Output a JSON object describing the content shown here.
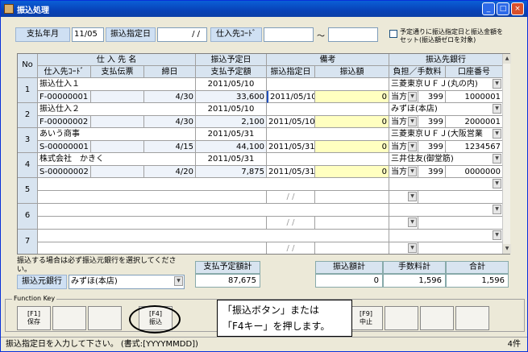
{
  "window": {
    "title": "振込処理",
    "minimize": "_",
    "maximize": "□",
    "close": "×"
  },
  "header": {
    "year_month_label": "支払年月",
    "year_month_value": "11/05",
    "transfer_date_label": "振込指定日",
    "transfer_date_value": "/ /",
    "supplier_code_label": "仕入先ｺｰﾄﾞ",
    "range_sep": "～",
    "checkbox_text": "予定通りに振込指定日と振込金額をセット(振込額ゼロを対象)"
  },
  "grid": {
    "h_no": "No",
    "h_supplier": "仕 入 先 名",
    "h_scheduled_date": "振込予定日",
    "h_remarks": "備考",
    "h_bank": "振込先銀行",
    "h_code": "仕入先ｺｰﾄﾞ",
    "h_slip": "支払伝票",
    "h_close": "締日",
    "h_scheduled_amount": "支払予定額",
    "h_designated": "振込指定日",
    "h_amount": "振込額",
    "h_fee": "負担／手数料",
    "h_account": "口座番号",
    "rows": [
      {
        "no": "1",
        "name": "振込仕入１",
        "code": "F-00000001",
        "close": "4/30",
        "date": "2011/05/10",
        "amount": "33,600",
        "designated": "2011/05/10",
        "transfer": "0",
        "bank": "三菱東京ＵＦＪ(丸の内)",
        "burden": "当方",
        "fee": "399",
        "account": "1000001"
      },
      {
        "no": "2",
        "name": "振込仕入２",
        "code": "F-00000002",
        "close": "4/30",
        "date": "2011/05/10",
        "amount": "2,100",
        "designated": "2011/05/10",
        "transfer": "0",
        "bank": "みずほ(本店)",
        "burden": "当方",
        "fee": "399",
        "account": "2000001"
      },
      {
        "no": "3",
        "name": "あいう商事",
        "code": "S-00000001",
        "close": "4/15",
        "date": "2011/05/31",
        "amount": "44,100",
        "designated": "2011/05/31",
        "transfer": "0",
        "bank": "三菱東京ＵＦＪ(大阪営業",
        "burden": "当方",
        "fee": "399",
        "account": "1234567"
      },
      {
        "no": "4",
        "name": "株式会社　かきく",
        "code": "S-00000002",
        "close": "4/20",
        "date": "2011/05/31",
        "amount": "7,875",
        "designated": "2011/05/31",
        "transfer": "0",
        "bank": "三井住友(御堂筋)",
        "burden": "当方",
        "fee": "399",
        "account": "0000000"
      },
      {
        "no": "5",
        "designated": "/ /"
      },
      {
        "no": "6",
        "designated": "/ /"
      },
      {
        "no": "7",
        "designated": "/ /"
      }
    ]
  },
  "footer": {
    "note": "振込する場合は必ず振込元銀行を選択してください。",
    "source_bank_label": "振込元銀行",
    "source_bank_value": "みずほ(本店)",
    "scheduled_total_label": "支払予定額計",
    "scheduled_total": "87,675",
    "transfer_total_label": "振込額計",
    "transfer_total": "0",
    "fee_total_label": "手数料計",
    "fee_total": "1,596",
    "grand_total_label": "合計",
    "grand_total": "1,596"
  },
  "fkeys": {
    "label": "Function Key",
    "f1_key": "[F1]",
    "f1_text": "保存",
    "f4_key": "[F4]",
    "f4_text": "振込",
    "f9_key": "[F9]",
    "f9_text": "中止"
  },
  "callout": {
    "line1": "「振込ボタン」または",
    "line2": "「F4キー」を押します。"
  },
  "status": {
    "message": "振込指定日を入力して下さい。 (書式:[YYYYMMDD])",
    "count": "4件"
  }
}
